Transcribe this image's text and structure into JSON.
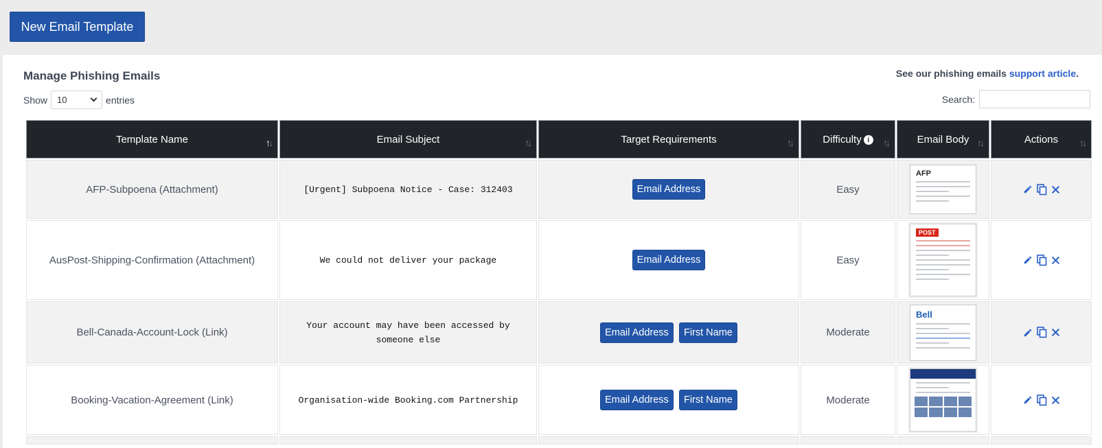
{
  "toolbar": {
    "new_template_label": "New Email Template"
  },
  "panel": {
    "title": "Manage Phishing Emails",
    "support_prefix": "See our phishing emails ",
    "support_link": "support article",
    "support_suffix": ".",
    "length_prefix": "Show",
    "length_value": "10",
    "length_suffix": "entries",
    "search_label": "Search:"
  },
  "table": {
    "columns": [
      {
        "label": "Template Name"
      },
      {
        "label": "Email Subject"
      },
      {
        "label": "Target Requirements"
      },
      {
        "label": "Difficulty"
      },
      {
        "label": "Email Body"
      },
      {
        "label": "Actions"
      }
    ],
    "rows": [
      {
        "name": "AFP-Subpoena (Attachment)",
        "subject": "[Urgent] Subpoena Notice - Case: 312403",
        "requirements": [
          "Email Address"
        ],
        "difficulty": "Easy",
        "thumb_logo": "AFP",
        "thumb_color": "#222222"
      },
      {
        "name": "AusPost-Shipping-Confirmation (Attachment)",
        "subject": "We could not deliver your package",
        "requirements": [
          "Email Address"
        ],
        "difficulty": "Easy",
        "thumb_logo": "POST",
        "thumb_color": "#d9261c"
      },
      {
        "name": "Bell-Canada-Account-Lock (Link)",
        "subject": "Your account may have been accessed by someone else",
        "requirements": [
          "Email Address",
          "First Name"
        ],
        "difficulty": "Moderate",
        "thumb_logo": "Bell",
        "thumb_color": "#1f5fb4"
      },
      {
        "name": "Booking-Vacation-Agreement (Link)",
        "subject": "Organisation-wide Booking.com Partnership",
        "requirements": [
          "Email Address",
          "First Name"
        ],
        "difficulty": "Moderate",
        "thumb_logo": "",
        "thumb_color": "#1d3b7c"
      }
    ]
  },
  "icons": {
    "edit": "pencil-icon",
    "copy": "copy-icon",
    "delete": "close-icon",
    "info": "info-icon",
    "sort": "sort-icon"
  },
  "colors": {
    "primary": "#2255a8",
    "header_bg": "#212429",
    "link": "#2a5fc9"
  }
}
